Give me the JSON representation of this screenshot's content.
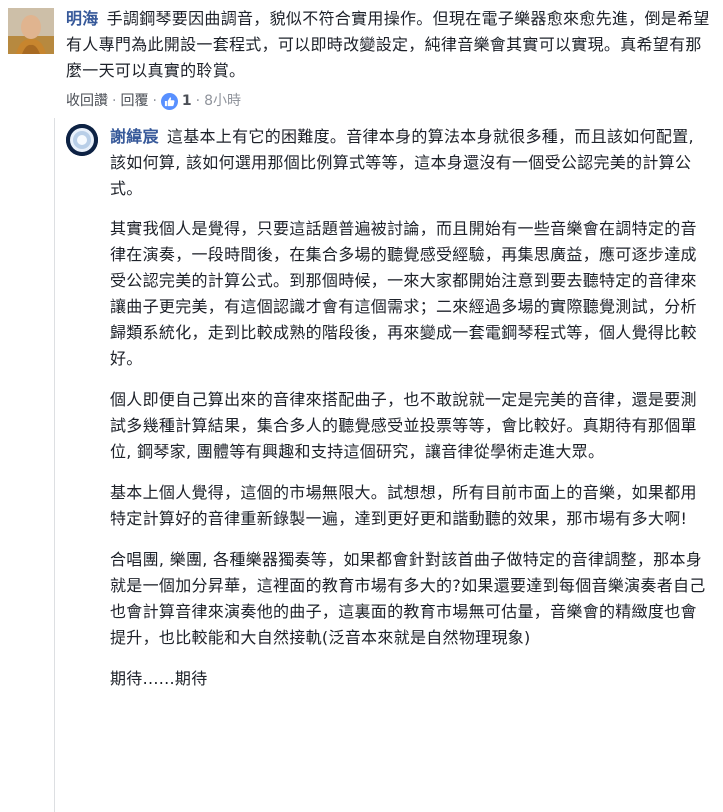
{
  "comment": {
    "author": "明海",
    "text": "手調鋼琴要因曲調音，貌似不符合實用操作。但現在電子樂器愈來愈先進，倒是希望有人專門為此開設一套程式，可以即時改變設定，純律音樂會其實可以實現。真希望有那麼一天可以真實的聆賞。",
    "actions": {
      "unlike_label": "收回讚",
      "reply_label": "回覆",
      "separator": "·",
      "like_count": "1",
      "time": "8小時"
    }
  },
  "reply": {
    "author": "謝緯宸",
    "paragraphs": [
      "這基本上有它的困難度。音律本身的算法本身就很多種，而且該如何配置, 該如何算, 該如何選用那個比例算式等等，這本身還沒有一個受公認完美的計算公式。",
      "其實我個人是覺得，只要這話題普遍被討論，而且開始有一些音樂會在調特定的音律在演奏，一段時間後，在集合多場的聽覺感受經驗，再集思廣益，應可逐步達成受公認完美的計算公式。到那個時候，一來大家都開始注意到要去聽特定的音律來讓曲子更完美，有這個認識才會有這個需求；二來經過多場的實際聽覺測試，分析歸類系統化，走到比較成熟的階段後，再來變成一套電鋼琴程式等，個人覺得比較好。",
      "個人即便自己算出來的音律來搭配曲子，也不敢說就一定是完美的音律，還是要測試多幾種計算結果，集合多人的聽覺感受並投票等等，會比較好。真期待有那個單位, 鋼琴家, 團體等有興趣和支持這個研究，讓音律從學術走進大眾。",
      "基本上個人覺得，這個的市場無限大。試想想，所有目前市面上的音樂，如果都用特定計算好的音律重新錄製一遍，達到更好更和諧動聽的效果，那市場有多大啊!",
      "合唱團, 樂團, 各種樂器獨奏等，如果都會針對該首曲子做特定的音律調整，那本身就是一個加分昇華，這裡面的教育市場有多大的?如果還要達到每個音樂演奏者自己也會計算音律來演奏他的曲子，這裏面的教育市場無可估量，音樂會的精緻度也會提升，也比較能和大自然接軌(泛音本來就是自然物理現象)",
      "期待......期待"
    ]
  },
  "colors": {
    "author": "#365899",
    "text": "#1d2129",
    "meta": "#90949c",
    "like_badge": "#5890ff"
  },
  "icons": {
    "like": "thumbs-up-icon"
  }
}
